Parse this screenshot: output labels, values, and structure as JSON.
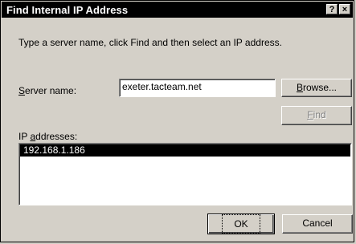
{
  "window": {
    "title": "Find Internal IP Address",
    "help_label": "?",
    "close_label": "×"
  },
  "instructions": "Type a server name, click Find and then select an IP address.",
  "server": {
    "label_prefix": "",
    "label_accel": "S",
    "label_rest": "erver name:",
    "value": "exeter.tacteam.net"
  },
  "buttons": {
    "browse_accel": "B",
    "browse_rest": "rowse...",
    "find_accel": "F",
    "find_rest": "ind",
    "ok_label": "OK",
    "cancel_label": "Cancel"
  },
  "ip_list": {
    "label_prefix": "IP ",
    "label_accel": "a",
    "label_rest": "ddresses:",
    "items": [
      "192.168.1.186"
    ],
    "selected_index": 0
  }
}
